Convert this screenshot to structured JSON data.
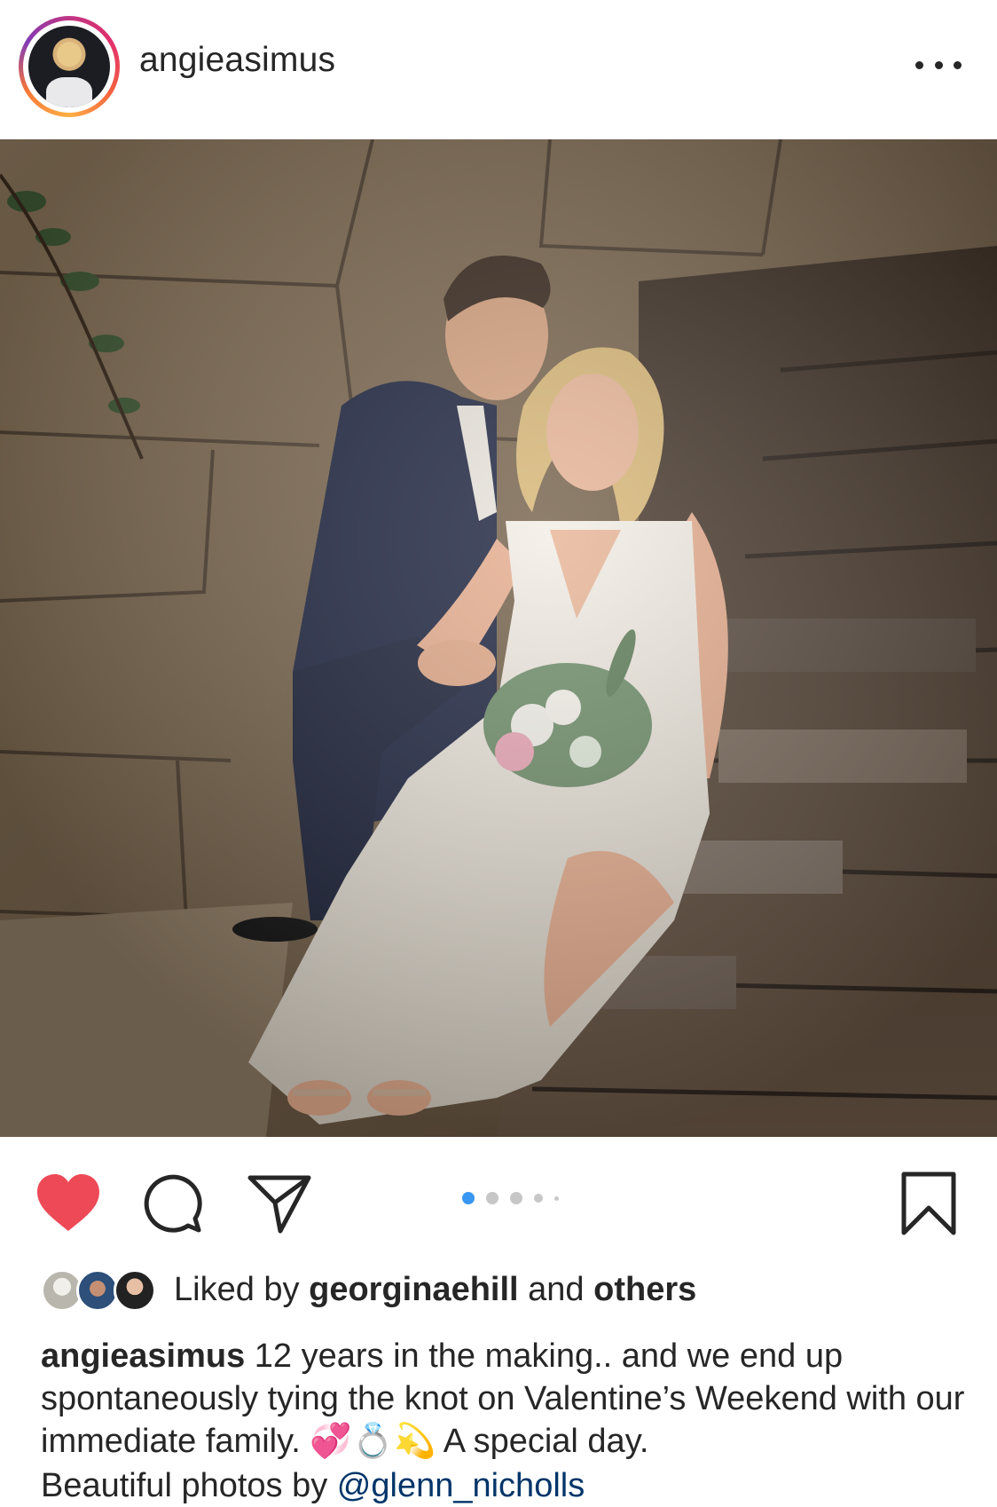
{
  "post": {
    "username": "angieasimus",
    "more_icon": "more-horizontal-icon",
    "carousel": {
      "count": 5,
      "active_index": 0
    },
    "colors": {
      "like_red": "#ed4956",
      "active_dot": "#3897f0",
      "inactive_dot": "#c7c7c7",
      "text": "#262626"
    }
  },
  "actions": {
    "like_icon": "heart-filled-icon",
    "comment_icon": "comment-icon",
    "share_icon": "send-icon",
    "save_icon": "bookmark-icon"
  },
  "likes": {
    "prefix": "Liked by",
    "user": "georginaehill",
    "middle": "and",
    "others": "others"
  },
  "caption": {
    "username": "angieasimus",
    "text": "12 years in the making.. and we end up spontaneously tying the knot on Valentine’s Weekend with our immediate family. 💞💍💫 A special day.",
    "next_line_prefix": "Beautiful photos by",
    "next_line_mention": "@glenn_nicholls"
  }
}
